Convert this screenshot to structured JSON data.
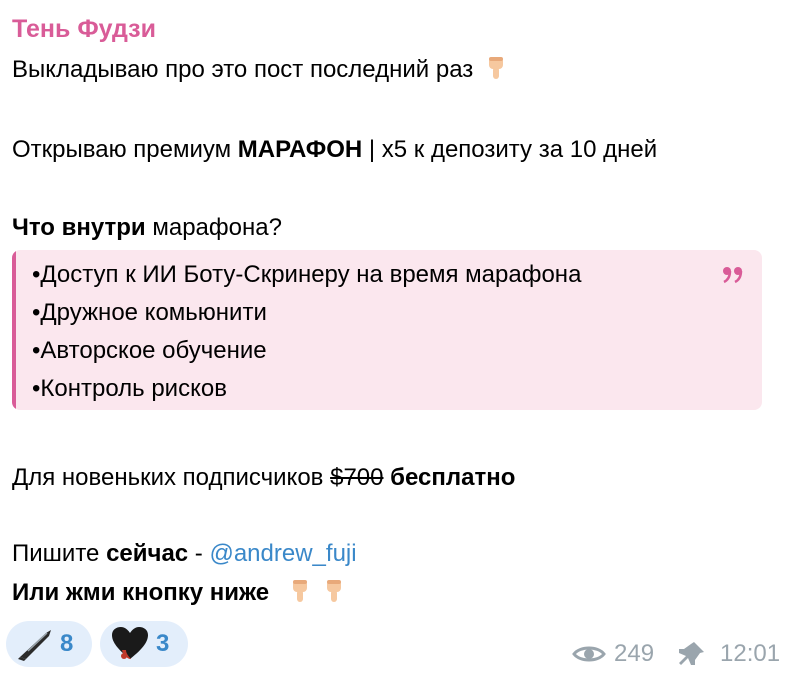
{
  "message": {
    "sender": "Тень Фудзи",
    "line1": "Выкладываю про это пост последний раз",
    "line2_prefix": "Открываю премиум ",
    "line2_bold": "МАРАФОН",
    "line2_suffix": " | x5 к депозиту за 10 дней",
    "line3_bold": "Что внутри",
    "line3_suffix": " марафона?",
    "quote": {
      "mark": "99",
      "items": [
        "•Доступ к ИИ Боту-Скринеру на время марафона",
        "•Дружное комьюнити",
        "•Авторское обучение",
        "•Контроль рисков"
      ]
    },
    "line4_prefix": "Для новеньких подписчиков ",
    "line4_strike": "$700",
    "line4_bold": " бесплатно",
    "line5_prefix": "Пишите ",
    "line5_bold": "сейчас",
    "line5_dash": " - ",
    "line5_mention": "@andrew_fuji",
    "line6_bold": "Или жми кнопку ниже",
    "hand_icon": "pointing-down-hand-icon",
    "accent_color": "#d95c98",
    "link_color": "#3a88c9"
  },
  "reactions": [
    {
      "icon": "knife-icon",
      "count": "8"
    },
    {
      "icon": "black-heart-icon",
      "count": "3"
    }
  ],
  "meta": {
    "views": "249",
    "time": "12:01"
  }
}
